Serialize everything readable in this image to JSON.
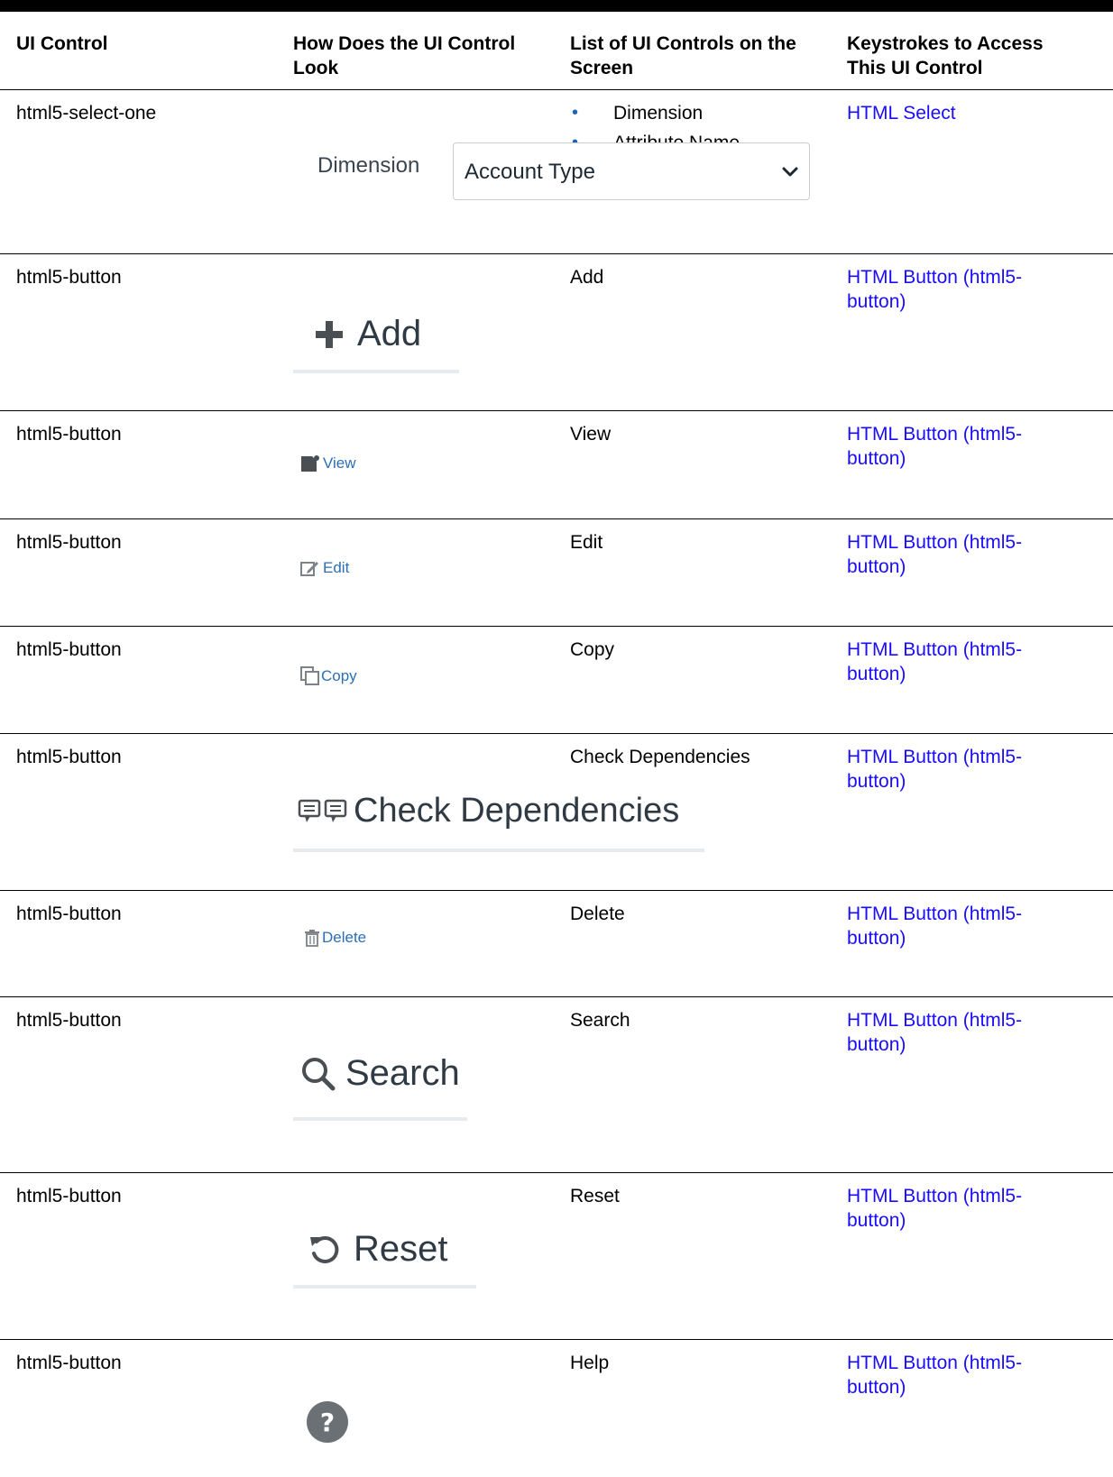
{
  "table": {
    "headers": [
      {
        "line1": "UI Control",
        "line2": ""
      },
      {
        "line1": "How Does the UI Control",
        "line2": "Look"
      },
      {
        "line1": "List of UI Controls on the",
        "line2": "Screen"
      },
      {
        "line1": "Keystrokes to Access",
        "line2": "This UI Control"
      }
    ],
    "rows": [
      {
        "control": "html5-select-one",
        "controls_list": [
          "Dimension",
          "Attribute Name"
        ],
        "keystroke_link": "HTML Select",
        "look": {
          "label": "Dimension",
          "value": "Account Type",
          "icon": "chevron-down-icon"
        }
      },
      {
        "control": "html5-button",
        "controls_list": [
          "Add"
        ],
        "keystroke_line1": "HTML Button (html5-",
        "keystroke_line2": "button)",
        "look": {
          "text": "Add",
          "icon": "plus-icon"
        }
      },
      {
        "control": "html5-button",
        "controls_list": [
          "View"
        ],
        "keystroke_line1": "HTML Button (html5-",
        "keystroke_line2": "button)",
        "look": {
          "text": "View",
          "icon": "document-view-icon"
        }
      },
      {
        "control": "html5-button",
        "controls_list": [
          "Edit"
        ],
        "keystroke_line1": "HTML Button (html5-",
        "keystroke_line2": "button)",
        "look": {
          "text": "Edit",
          "icon": "pencil-square-icon"
        }
      },
      {
        "control": "html5-button",
        "controls_list": [
          "Copy"
        ],
        "keystroke_line1": "HTML Button (html5-",
        "keystroke_line2": "button)",
        "look": {
          "text": "Copy",
          "icon": "copy-icon"
        }
      },
      {
        "control": "html5-button",
        "controls_list": [
          "Check Dependencies"
        ],
        "keystroke_line1": "HTML Button (html5-",
        "keystroke_line2": "button)",
        "look": {
          "text": "Check Dependencies",
          "icon": "dependencies-icon"
        }
      },
      {
        "control": "html5-button",
        "controls_list": [
          "Delete"
        ],
        "keystroke_line1": "HTML Button (html5-",
        "keystroke_line2": "button)",
        "look": {
          "text": "Delete",
          "icon": "trash-icon"
        }
      },
      {
        "control": "html5-button",
        "controls_list": [
          "Search"
        ],
        "keystroke_line1": "HTML Button (html5-",
        "keystroke_line2": "button)",
        "look": {
          "text": "Search",
          "icon": "search-icon"
        }
      },
      {
        "control": "html5-button",
        "controls_list": [
          "Reset"
        ],
        "keystroke_line1": "HTML Button (html5-",
        "keystroke_line2": "button)",
        "look": {
          "text": "Reset",
          "icon": "reset-icon"
        }
      },
      {
        "control": "html5-button",
        "controls_list": [
          "Help"
        ],
        "keystroke_line1": "HTML Button (html5-",
        "keystroke_line2": "button)",
        "look": {
          "icon": "help-icon"
        }
      }
    ]
  },
  "colors": {
    "link": "#1a0dff",
    "bullet": "#1c64b8",
    "rule": "#000000"
  }
}
